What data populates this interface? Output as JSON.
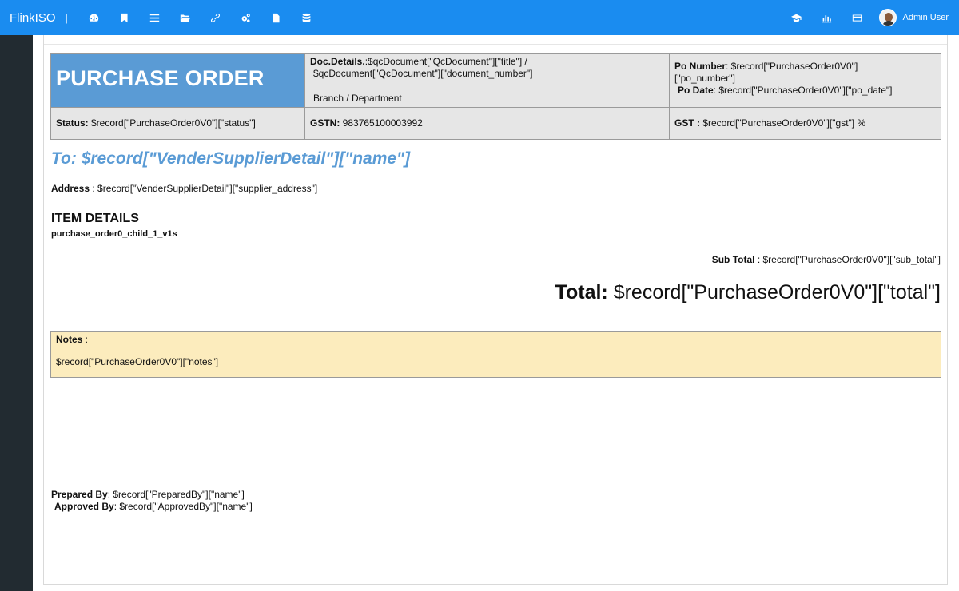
{
  "app": {
    "brand": "FlinkISO",
    "separator": "|",
    "nav_icons": [
      "dashboard-icon",
      "bookmark-icon",
      "list-icon",
      "folder-icon",
      "link-icon",
      "cogs-icon",
      "file-icon",
      "database-icon"
    ],
    "right_icons": [
      "graduation-cap-icon",
      "bar-chart-icon",
      "credit-card-icon"
    ],
    "user": "Admin User",
    "colors": {
      "navbar": "#1a8cf0",
      "sidebar": "#222b31",
      "title_blue": "#5a9bd5",
      "notes_bg": "#fcecbd",
      "cell_bg": "#e6e6e6"
    }
  },
  "po": {
    "title": "PURCHASE ORDER",
    "doc_details_label": "Doc.Details.",
    "doc_details_value": ":$qcDocument[\"QcDocument\"][\"title\"] /",
    "doc_details_value2": "$qcDocument[\"QcDocument\"][\"document_number\"]",
    "branch": "Branch / Department",
    "po_number_label": "Po Number",
    "po_number_value": ": $record[\"PurchaseOrder0V0\"]",
    "po_number_value2": "[\"po_number\"]",
    "po_date_label": "Po Date",
    "po_date_value": ": $record[\"PurchaseOrder0V0\"][\"po_date\"]",
    "status_label": "Status:",
    "status_value": " $record[\"PurchaseOrder0V0\"][\"status\"]",
    "gstn_label": "GSTN:",
    "gstn_value": " 983765100003992",
    "gst_label": "GST :",
    "gst_value": " $record[\"PurchaseOrder0V0\"][\"gst\"] %",
    "to": "To: $record[\"VenderSupplierDetail\"][\"name\"]",
    "address_label": "Address",
    "address_value": " : $record[\"VenderSupplierDetail\"][\"supplier_address\"]",
    "item_details": "ITEM DETAILS",
    "item_sub": "purchase_order0_child_1_v1s",
    "sub_total_label": "Sub Total",
    "sub_total_value": " : $record[\"PurchaseOrder0V0\"][\"sub_total\"]",
    "total_label": "Total:",
    "total_value": " $record[\"PurchaseOrder0V0\"][\"total\"]",
    "notes_label": "Notes",
    "notes_colon": " :",
    "notes_value": "$record[\"PurchaseOrder0V0\"][\"notes\"]",
    "prepared_label": "Prepared By",
    "prepared_value": ": $record[\"PreparedBy\"][\"name\"]",
    "approved_label": "Approved By",
    "approved_value": ": $record[\"ApprovedBy\"][\"name\"]"
  }
}
